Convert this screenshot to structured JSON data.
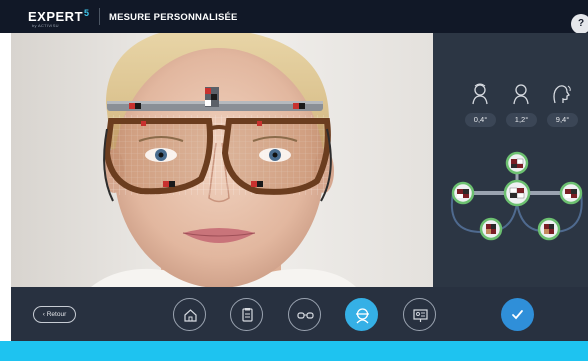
{
  "header": {
    "logo_text": "EXPERT",
    "logo_sup": "5",
    "logo_sub": "by ACTIVISU",
    "title": "MESURE PERSONNALISÉE",
    "help_label": "?"
  },
  "panel": {
    "angles": [
      {
        "icon": "head-tilt-icon",
        "value": "0,4°"
      },
      {
        "icon": "head-pose-icon",
        "value": "1,2°"
      },
      {
        "icon": "head-rotation-icon",
        "value": "9,4°"
      }
    ]
  },
  "toolbar": {
    "back_label": "Retour",
    "buttons": [
      {
        "icon": "home-icon",
        "active": false
      },
      {
        "icon": "document-icon",
        "active": false
      },
      {
        "icon": "glasses-icon",
        "active": false
      },
      {
        "icon": "face-measure-icon",
        "active": true
      },
      {
        "icon": "presentation-icon",
        "active": false
      }
    ],
    "confirm_icon": "check-icon"
  },
  "colors": {
    "topbar": "#111827",
    "panel": "#2c3644",
    "toolbar": "#283140",
    "accent": "#35b0e6",
    "confirm": "#2f8fd9",
    "footer_bar": "#1ec3f0",
    "marker_frame": "#6cc070"
  }
}
